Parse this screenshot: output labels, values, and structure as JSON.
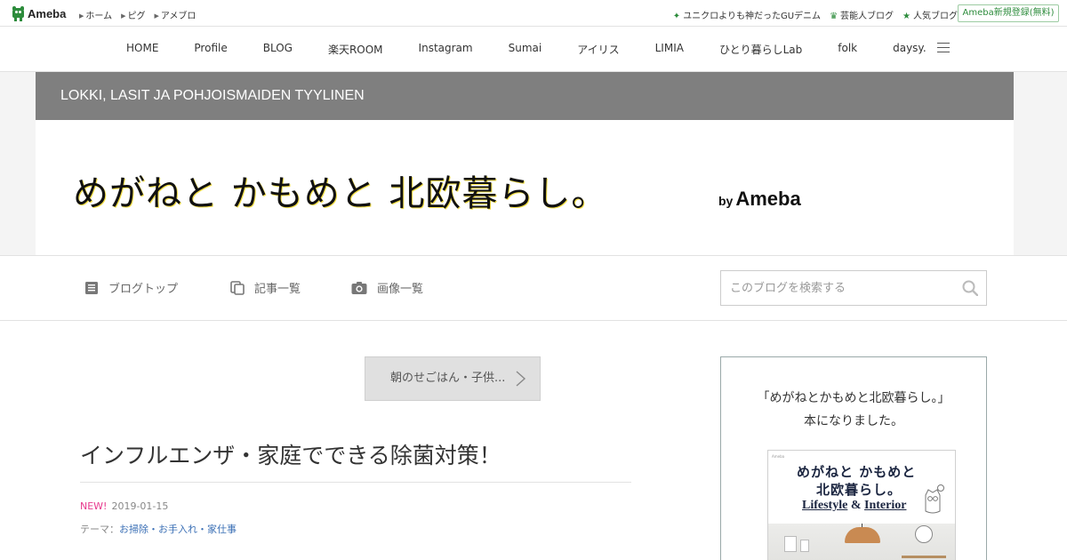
{
  "topbar": {
    "logo_text": "Ameba",
    "links": [
      "ホーム",
      "ピグ",
      "アメブロ"
    ],
    "right_links": [
      {
        "icon": "sparkle-icon",
        "label": "ユニクロよりも神だったGUデニム"
      },
      {
        "icon": "crown-icon",
        "label": "芸能人ブログ"
      },
      {
        "icon": "star-icon",
        "label": "人気ブログ"
      }
    ],
    "signup_label": "Ameba新規登録(無料)"
  },
  "gnav": {
    "items": [
      "HOME",
      "Profile",
      "BLOG",
      "楽天ROOM",
      "Instagram",
      "Sumai",
      "アイリス",
      "LIMIA",
      "ひとり暮らしLab",
      "folk",
      "daysy."
    ]
  },
  "header": {
    "strip_text": "LOKKI, LASIT JA POHJOISMAIDEN TYYLINEN",
    "title": "めがねと かもめと 北欧暮らし。",
    "by": "by",
    "brand": "Ameba"
  },
  "blog_menu": {
    "top_label": "ブログトップ",
    "list_label": "記事一覧",
    "images_label": "画像一覧",
    "search_placeholder": "このブログを検索する"
  },
  "main": {
    "prev_label": "朝のせごはん・子供...",
    "post_title": "インフルエンザ・家庭でできる除菌対策！",
    "new_label": "NEW!",
    "date": "2019-01-15",
    "theme_prefix": "テーマ：",
    "theme": "お掃除・お手入れ・家仕事"
  },
  "sidebar": {
    "line1": "「めがねとかもめと北欧暮らし。」",
    "line2": "本になりました。",
    "book_line1": "めがねと かもめと",
    "book_line2": "北欧暮らし。",
    "book_sub_a": "Lifestyle",
    "book_sub_amp": " & ",
    "book_sub_b": "Interior",
    "book_small": "Ameba"
  },
  "colors": {
    "ameba_green": "#2d8c3c",
    "header_strip": "#7f7f7f",
    "link_blue": "#3a6fb5",
    "new_pink": "#e7388d"
  }
}
